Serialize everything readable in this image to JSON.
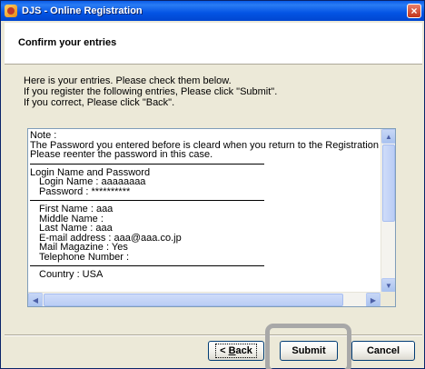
{
  "window": {
    "title": "DJS - Online Registration"
  },
  "header": {
    "title": "Confirm your entries"
  },
  "intro": [
    "Here is your entries. Please check them below.",
    "If you register the following entries, Please click \"Submit\".",
    "If you correct, Please click \"Back\"."
  ],
  "content": {
    "note_title": "Note :",
    "note_line1": "The Password you entered before is cleard when you return to the Registration Form",
    "note_line2": "Please reenter the password in this case.",
    "login_title": "Login Name and Password",
    "login_name": "Login Name : aaaaaaaa",
    "password": "Password : **********",
    "first_name": "First Name : aaa",
    "middle_name": "Middle Name :",
    "last_name": "Last Name : aaa",
    "email": "E-mail address : aaa@aaa.co.jp",
    "mail_magazine": "Mail Magazine : Yes",
    "telephone": "Telephone Number :",
    "country": "Country : USA"
  },
  "buttons": {
    "back_prefix": "< ",
    "back_accel": "B",
    "back_rest": "ack",
    "submit": "Submit",
    "cancel": "Cancel"
  },
  "icons": {
    "close": "×",
    "up": "▲",
    "down": "▼",
    "left": "◀",
    "right": "▶"
  }
}
